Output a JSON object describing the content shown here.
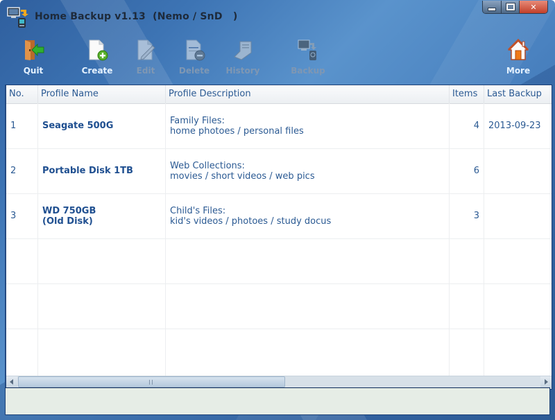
{
  "window": {
    "title": "Home Backup v1.13  (Nemo / SnD   )",
    "controls": {
      "minimize": "minimize",
      "maximize": "maximize",
      "close": "✕"
    }
  },
  "toolbar": {
    "buttons": [
      {
        "label": "Quit",
        "icon": "exit-door-icon",
        "enabled": true
      },
      {
        "label": "Create",
        "icon": "new-document-icon",
        "enabled": true
      },
      {
        "label": "Edit",
        "icon": "edit-document-icon",
        "enabled": false
      },
      {
        "label": "Delete",
        "icon": "delete-document-icon",
        "enabled": false
      },
      {
        "label": "History",
        "icon": "history-scroll-icon",
        "enabled": false
      },
      {
        "label": "Backup",
        "icon": "backup-computer-icon",
        "enabled": false
      },
      {
        "label": "More",
        "icon": "home-icon",
        "enabled": true
      }
    ]
  },
  "table": {
    "columns": [
      "No.",
      "Profile Name",
      "Profile Description",
      "Items",
      "Last Backup"
    ],
    "rows": [
      {
        "no": "1",
        "name_line1": "Seagate 500G",
        "name_line2": "",
        "desc_line1": "Family Files:",
        "desc_line2": "home photoes / personal files",
        "items": "4",
        "last_backup": "2013-09-23"
      },
      {
        "no": "2",
        "name_line1": "Portable Disk 1TB",
        "name_line2": "",
        "desc_line1": "Web Collections:",
        "desc_line2": "movies / short videos / web pics",
        "items": "6",
        "last_backup": ""
      },
      {
        "no": "3",
        "name_line1": "WD 750GB",
        "name_line2": "(Old Disk)",
        "desc_line1": "Child's Files:",
        "desc_line2": "kid's videos / photoes / study docus",
        "items": "3",
        "last_backup": ""
      }
    ],
    "empty_rows": 3
  },
  "statusbar": {
    "text": ""
  }
}
